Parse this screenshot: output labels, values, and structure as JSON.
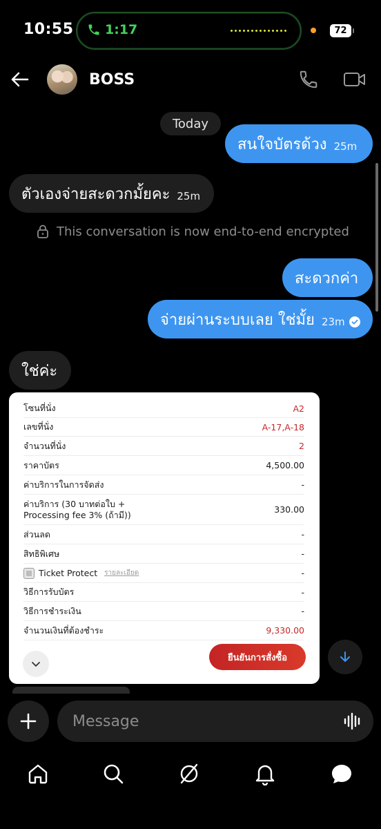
{
  "status_bar": {
    "time": "10:55",
    "call_timer": "1:17",
    "battery": "72"
  },
  "header": {
    "contact_name": "BOSS"
  },
  "date_divider": "Today",
  "messages": [
    {
      "direction": "outgoing",
      "text": "สนใจบัตรด้วง",
      "time": "25m"
    },
    {
      "direction": "incoming",
      "text": "ตัวเองจ่ายสะดวกมั้ยคะ",
      "time": "25m"
    },
    {
      "direction": "outgoing",
      "text": "สะดวกค่า",
      "time": ""
    },
    {
      "direction": "outgoing",
      "text": "จ่ายผ่านระบบเลย ใช่มั้ย",
      "time": "23m",
      "read": true
    },
    {
      "direction": "incoming",
      "text": "ใช่ค่ะ",
      "time": ""
    }
  ],
  "encryption_notice": "This conversation is now end-to-end encrypted",
  "order_card": {
    "rows": [
      {
        "label": "โซนที่นั่ง",
        "value": "A2"
      },
      {
        "label": "เลขที่นั่ง",
        "value": "A-17,A-18"
      },
      {
        "label": "จำนวนที่นั่ง",
        "value": "2"
      },
      {
        "label": "ราคาบัตร",
        "value": "4,500.00"
      },
      {
        "label": "ค่าบริการในการจัดส่ง",
        "value": "-"
      },
      {
        "label": "ค่าบริการ (30 บาทต่อใบ + Processing fee 3% (ถ้ามี))",
        "value": "330.00"
      },
      {
        "label": "ส่วนลด",
        "value": "-"
      },
      {
        "label": "สิทธิพิเศษ",
        "value": "-"
      },
      {
        "label": "Ticket Protect",
        "value": "-",
        "link": "รายละเอียด"
      },
      {
        "label": "วิธีการรับบัตร",
        "value": "-"
      },
      {
        "label": "วิธีการชำระเงิน",
        "value": "-"
      },
      {
        "label": "จำนวนเงินที่ต้องชำระ",
        "value": "9,330.00"
      }
    ],
    "confirm_button": "ยืนยันการสั่งซื้อ"
  },
  "composer": {
    "placeholder": "Message"
  },
  "colors": {
    "outgoing_bubble": "#3d95f0",
    "incoming_bubble": "#1f1f1f",
    "accent_red": "#c62828",
    "call_green": "#43d15a"
  },
  "icons": {
    "nav": [
      "home-icon",
      "search-icon",
      "explore-icon",
      "notifications-icon",
      "messages-icon"
    ]
  }
}
